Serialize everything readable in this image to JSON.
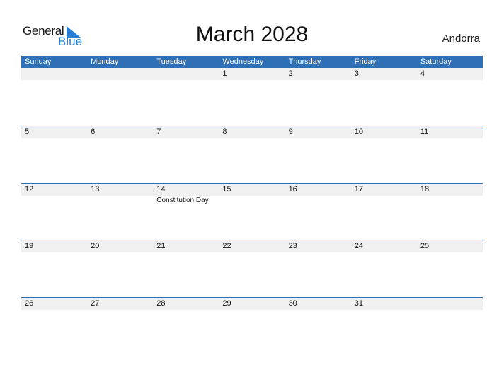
{
  "logo": {
    "word1": "General",
    "word2": "Blue"
  },
  "title": "March 2028",
  "country": "Andorra",
  "colors": {
    "header_bg": "#2e6fb5",
    "day_strip_bg": "#f0f0f0",
    "logo_blue": "#2a7fd4"
  },
  "weekdays": [
    "Sunday",
    "Monday",
    "Tuesday",
    "Wednesday",
    "Thursday",
    "Friday",
    "Saturday"
  ],
  "weeks": [
    {
      "days": [
        "",
        "",
        "",
        "1",
        "2",
        "3",
        "4"
      ],
      "events": [
        "",
        "",
        "",
        "",
        "",
        "",
        ""
      ]
    },
    {
      "days": [
        "5",
        "6",
        "7",
        "8",
        "9",
        "10",
        "11"
      ],
      "events": [
        "",
        "",
        "",
        "",
        "",
        "",
        ""
      ]
    },
    {
      "days": [
        "12",
        "13",
        "14",
        "15",
        "16",
        "17",
        "18"
      ],
      "events": [
        "",
        "",
        "Constitution Day",
        "",
        "",
        "",
        ""
      ]
    },
    {
      "days": [
        "19",
        "20",
        "21",
        "22",
        "23",
        "24",
        "25"
      ],
      "events": [
        "",
        "",
        "",
        "",
        "",
        "",
        ""
      ]
    },
    {
      "days": [
        "26",
        "27",
        "28",
        "29",
        "30",
        "31",
        ""
      ],
      "events": [
        "",
        "",
        "",
        "",
        "",
        "",
        ""
      ]
    }
  ]
}
